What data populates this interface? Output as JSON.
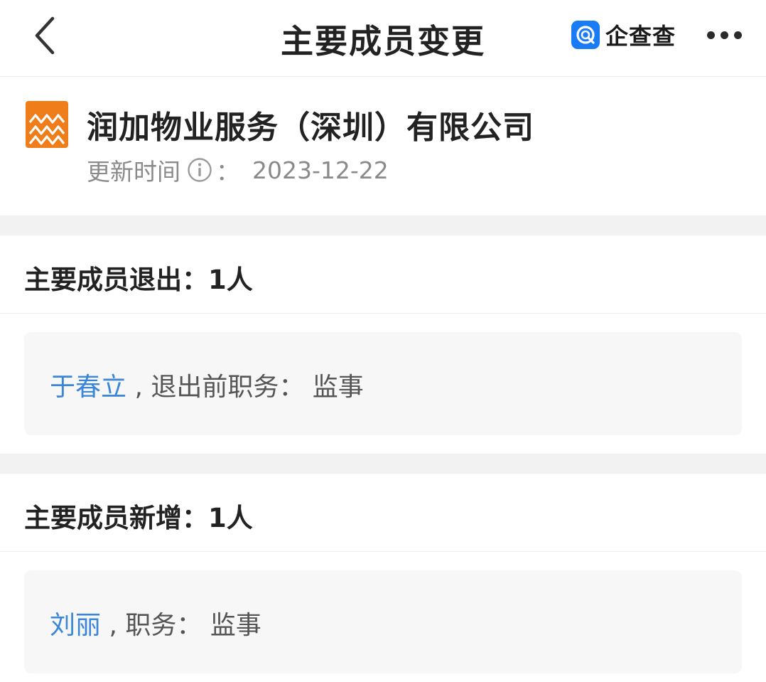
{
  "nav": {
    "title": "主要成员变更",
    "brand_name": "企查查",
    "brand_color": "#1a7cf5",
    "back_icon": "chevron-left-icon",
    "more_icon": "more-horizontal-icon"
  },
  "company": {
    "name": "润加物业服务（深圳）有限公司",
    "logo_color": "#ef7d1a",
    "update_label": "更新时间",
    "update_colon": "：",
    "update_date": "2023-12-22"
  },
  "exit_section": {
    "title": "主要成员退出：",
    "count": "1人",
    "items": [
      {
        "name": "于春立",
        "sep": " , ",
        "desc": "退出前职务：  监事"
      }
    ]
  },
  "new_section": {
    "title": "主要成员新增：",
    "count": "1人",
    "items": [
      {
        "name": "刘丽",
        "sep": " , ",
        "desc": "职务：  监事"
      }
    ]
  },
  "colors": {
    "link": "#3a86d8",
    "gap_bg": "#f2f2f2",
    "card_bg": "#f7f7f7"
  }
}
